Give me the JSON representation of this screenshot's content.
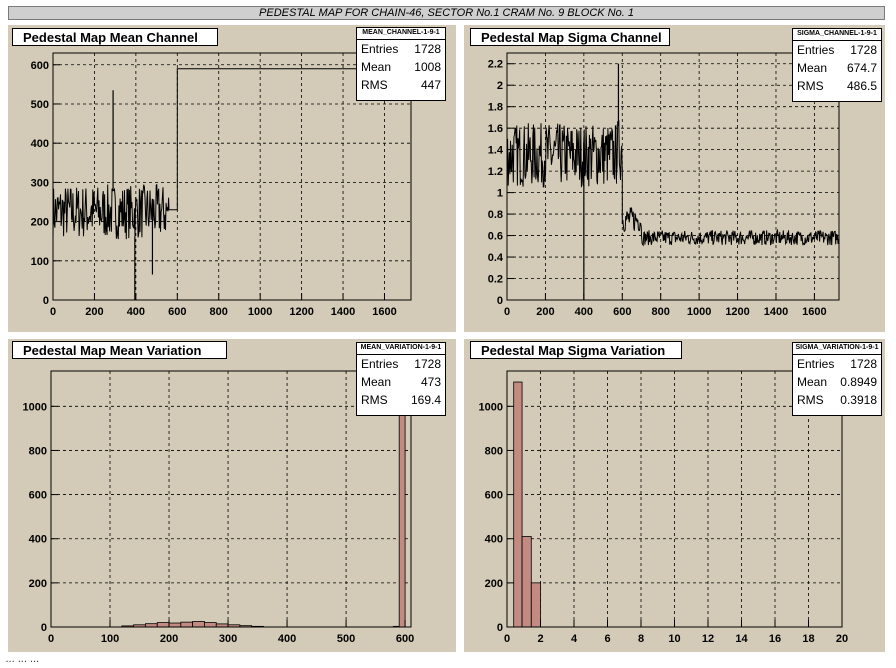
{
  "banner": "PEDESTAL MAP FOR CHAIN-46, SECTOR No.1 CRAM No. 9 BLOCK No. 1",
  "footer": "... ... ...",
  "colors": {
    "pad": "#d3cbb7",
    "line": "#000000",
    "fill": "#c38a82"
  },
  "chart_data": [
    {
      "type": "line",
      "title": "Pedestal Map Mean Channel",
      "stats": {
        "name": "MEAN_CHANNEL-1-9-1",
        "entries": "1728",
        "mean": "1008",
        "rms": "447"
      },
      "xlim": [
        0,
        1728
      ],
      "ylim": [
        0,
        630
      ],
      "xticks": [
        0,
        200,
        400,
        600,
        800,
        1000,
        1200,
        1400,
        1600
      ],
      "yticks": [
        0,
        100,
        200,
        300,
        400,
        500,
        600
      ],
      "spikes": [
        {
          "x": 290,
          "y": 535
        },
        {
          "x": 395,
          "y": 0
        },
        {
          "x": 480,
          "y": 65
        }
      ],
      "segments": [
        {
          "x0": 0,
          "x1": 560,
          "base": 225,
          "noise": 70
        },
        {
          "x0": 560,
          "x1": 600,
          "base": 230,
          "noise": 0
        },
        {
          "x0": 600,
          "x1": 1728,
          "base": 590,
          "noise": 0
        }
      ]
    },
    {
      "type": "line",
      "title": "Pedestal Map Sigma Channel",
      "stats": {
        "name": "SIGMA_CHANNEL-1-9-1",
        "entries": "1728",
        "mean": "674.7",
        "rms": "486.5"
      },
      "xlim": [
        0,
        1728
      ],
      "ylim": [
        0,
        2.3
      ],
      "xticks": [
        0,
        200,
        400,
        600,
        800,
        1000,
        1200,
        1400,
        1600
      ],
      "yticks": [
        0,
        0.2,
        0.4,
        0.6,
        0.8,
        1,
        1.2,
        1.4,
        1.6,
        1.8,
        2,
        2.2
      ],
      "spikes": [
        {
          "x": 400,
          "y": 0
        },
        {
          "x": 580,
          "y": 2.2
        }
      ],
      "segments": [
        {
          "x0": 0,
          "x1": 570,
          "base": 1.35,
          "noise": 0.3
        },
        {
          "x0": 570,
          "x1": 600,
          "base": 1.4,
          "noise": 0.3
        },
        {
          "x0": 600,
          "x1": 700,
          "base": 0.75,
          "noise": 0.12
        },
        {
          "x0": 700,
          "x1": 1728,
          "base": 0.58,
          "noise": 0.07
        }
      ]
    },
    {
      "type": "bar",
      "title": "Pedestal Map Mean Variation",
      "stats": {
        "name": "MEAN_VARIATION-1-9-1",
        "entries": "1728",
        "mean": "473",
        "rms": "169.4"
      },
      "xlim": [
        0,
        610
      ],
      "ylim": [
        0,
        1160
      ],
      "xticks": [
        0,
        100,
        200,
        300,
        400,
        500,
        600
      ],
      "yticks": [
        0,
        200,
        400,
        600,
        800,
        1000
      ],
      "bins": [
        {
          "x0": 120,
          "x1": 140,
          "v": 5
        },
        {
          "x0": 140,
          "x1": 160,
          "v": 10
        },
        {
          "x0": 160,
          "x1": 180,
          "v": 15
        },
        {
          "x0": 180,
          "x1": 200,
          "v": 20
        },
        {
          "x0": 200,
          "x1": 220,
          "v": 18
        },
        {
          "x0": 220,
          "x1": 240,
          "v": 22
        },
        {
          "x0": 240,
          "x1": 260,
          "v": 25
        },
        {
          "x0": 260,
          "x1": 280,
          "v": 20
        },
        {
          "x0": 280,
          "x1": 300,
          "v": 14
        },
        {
          "x0": 300,
          "x1": 320,
          "v": 10
        },
        {
          "x0": 320,
          "x1": 340,
          "v": 6
        },
        {
          "x0": 340,
          "x1": 360,
          "v": 3
        },
        {
          "x0": 580,
          "x1": 590,
          "v": 3
        },
        {
          "x0": 590,
          "x1": 600,
          "v": 1130
        }
      ]
    },
    {
      "type": "bar",
      "title": "Pedestal Map Sigma Variation",
      "stats": {
        "name": "SIGMA_VARIATION-1-9-1",
        "entries": "1728",
        "mean": "0.8949",
        "rms": "0.3918"
      },
      "xlim": [
        0,
        20
      ],
      "ylim": [
        0,
        1160
      ],
      "xticks": [
        0,
        2,
        4,
        6,
        8,
        10,
        12,
        14,
        16,
        18,
        20
      ],
      "yticks": [
        0,
        200,
        400,
        600,
        800,
        1000
      ],
      "bins": [
        {
          "x0": 0.4,
          "x1": 0.9,
          "v": 1110
        },
        {
          "x0": 0.9,
          "x1": 1.45,
          "v": 410
        },
        {
          "x0": 1.45,
          "x1": 2.0,
          "v": 200
        }
      ]
    }
  ]
}
